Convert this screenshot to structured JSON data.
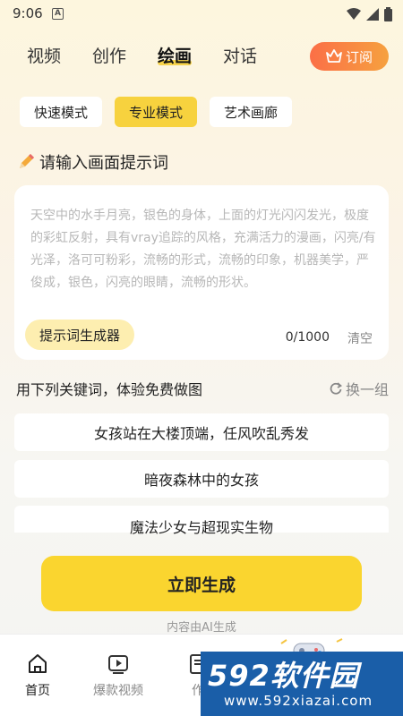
{
  "status": {
    "time": "9:06",
    "notif": "A"
  },
  "top_tabs": [
    "视频",
    "创作",
    "绘画",
    "对话"
  ],
  "subscribe_label": "订阅",
  "modes": [
    "快速模式",
    "专业模式",
    "艺术画廊"
  ],
  "section_title": "请输入画面提示词",
  "prompt": {
    "placeholder": "天空中的水手月亮，银色的身体，上面的灯光闪闪发光，极度的彩虹反射，具有vray追踪的风格，充满活力的漫画，闪亮/有光泽，洛可可粉彩，流畅的形式，流畅的印象，机器美学，严俊成，银色，闪亮的眼睛，流畅的形状。",
    "generator_label": "提示词生成器",
    "counter": "0/1000",
    "clear_label": "清空"
  },
  "keywords": {
    "heading": "用下列关键词，体验免费做图",
    "refresh_label": "换一组",
    "items": [
      "女孩站在大楼顶端，任风吹乱秀发",
      "暗夜森林中的女孩",
      "魔法少女与超现实生物"
    ]
  },
  "submit_label": "立即生成",
  "ai_note": "内容由AI生成",
  "nav": [
    "首页",
    "爆款视频",
    "作"
  ],
  "watermark": {
    "brand": "592软件园",
    "url": "www.592xiazai.com"
  },
  "colors": {
    "accent": "#f7d23e",
    "subscribe": "#fb6f47",
    "watermark_bg": "#1a5ea8"
  }
}
